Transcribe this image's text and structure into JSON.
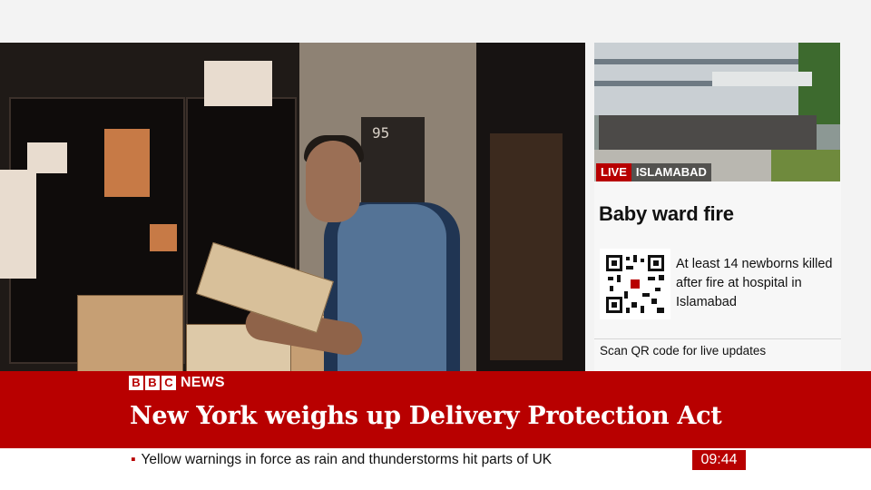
{
  "sidebar": {
    "live_label": "LIVE",
    "location": "ISLAMABAD",
    "title": "Baby ward fire",
    "summary": "At least 14 newborns killed after fire at hospital in Islamabad",
    "scan_text": "Scan QR code for live updates"
  },
  "video": {
    "door_number": "95"
  },
  "banner": {
    "logo_letters": [
      "B",
      "B",
      "C"
    ],
    "logo_news": "NEWS",
    "headline": "New York weighs up Delivery Protection Act"
  },
  "ticker": {
    "bullet": "▪",
    "text": "Yellow warnings in force as rain and thunderstorms hit parts of UK"
  },
  "clock": "09:44",
  "colors": {
    "bbc_red": "#b80000",
    "white": "#ffffff"
  },
  "icons": [
    "qr-code-icon",
    "live-indicator"
  ]
}
